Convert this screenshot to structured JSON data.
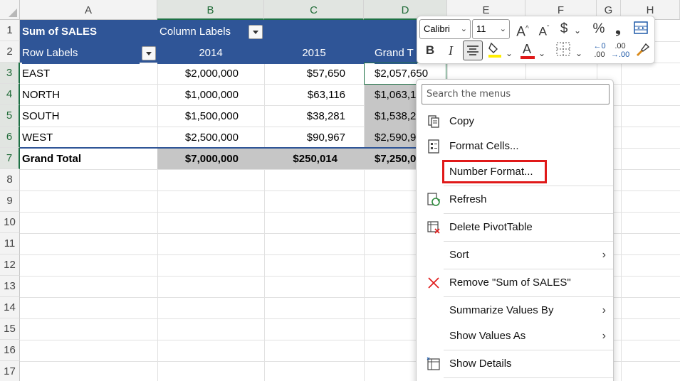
{
  "columns": [
    "A",
    "B",
    "C",
    "D",
    "E",
    "F",
    "G",
    "H"
  ],
  "rows": [
    "1",
    "2",
    "3",
    "4",
    "5",
    "6",
    "7",
    "8",
    "9",
    "10",
    "11",
    "12",
    "13",
    "14",
    "15",
    "16",
    "17"
  ],
  "pivot": {
    "header1": "Sum of SALES",
    "column_labels": "Column Labels",
    "row_labels": "Row Labels",
    "col_2014": "2014",
    "col_2015": "2015",
    "grand_total_header": "Grand T",
    "data": [
      {
        "label": "EAST",
        "y2014": "$2,000,000",
        "y2015": "$57,650",
        "total": "$2,057,650"
      },
      {
        "label": "NORTH",
        "y2014": "$1,000,000",
        "y2015": "$63,116",
        "total": "$1,063,1"
      },
      {
        "label": "SOUTH",
        "y2014": "$1,500,000",
        "y2015": "$38,281",
        "total": "$1,538,2"
      },
      {
        "label": "WEST",
        "y2014": "$2,500,000",
        "y2015": "$90,967",
        "total": "$2,590,9"
      }
    ],
    "grand_total": {
      "label": "Grand Total",
      "y2014": "$7,000,000",
      "y2015": "$250,014",
      "total": "$7,250,0"
    }
  },
  "mini_toolbar": {
    "font_name": "Calibri",
    "font_size": "11",
    "grow_font": "A",
    "shrink_font": "A",
    "currency": "$",
    "percent": "%",
    "comma": "❟",
    "bold": "B",
    "italic": "I",
    "font_color_letter": "A",
    "dec_increase": ".00",
    "dec_decrease": ".00"
  },
  "context_menu": {
    "search_placeholder": "Search the menus",
    "items": [
      {
        "label": "Copy",
        "icon": "copy-icon"
      },
      {
        "label": "Format Cells...",
        "icon": "format-cells-icon"
      },
      {
        "label": "Number Format...",
        "icon": ""
      },
      {
        "label": "Refresh",
        "icon": "refresh-icon"
      },
      {
        "label": "Delete PivotTable",
        "icon": "delete-pivot-icon"
      },
      {
        "label": "Sort",
        "icon": ""
      },
      {
        "label": "Remove \"Sum of SALES\"",
        "icon": "remove-x-icon"
      },
      {
        "label": "Summarize Values By",
        "icon": ""
      },
      {
        "label": "Show Values As",
        "icon": ""
      },
      {
        "label": "Show Details",
        "icon": "show-details-icon"
      }
    ]
  },
  "colors": {
    "pivot_header": "#2f5597",
    "grand_total_fill": "#c6c6c6",
    "highlight_box": "#e01919",
    "selection": "#1e7145"
  }
}
